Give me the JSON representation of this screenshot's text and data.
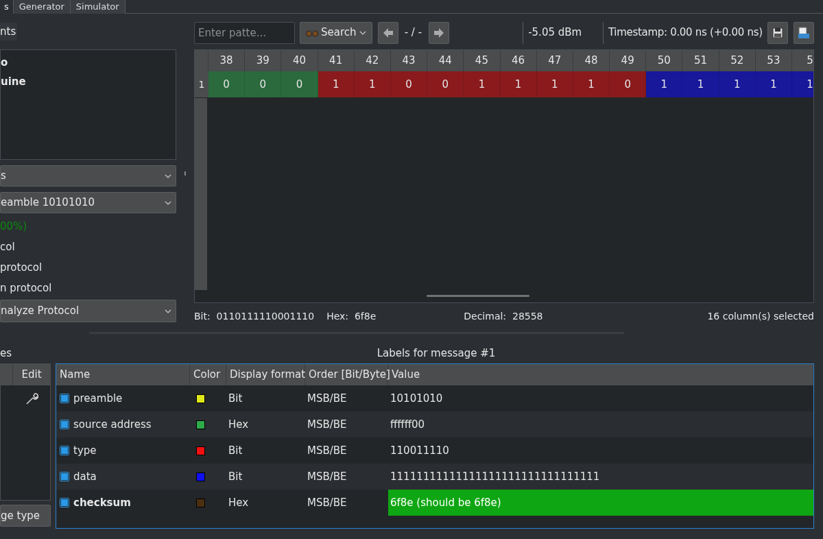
{
  "tabs": [
    {
      "label": "s",
      "selected": true
    },
    {
      "label": "Generator",
      "selected": false
    },
    {
      "label": "Simulator",
      "selected": false
    }
  ],
  "left_panel": {
    "tab": "nts",
    "list_items": [
      "o",
      "uine"
    ],
    "combo_1": "s",
    "combo_2": "eamble 10101010",
    "match_status": "00%)",
    "options": [
      "col",
      "protocol",
      "n protocol"
    ],
    "combo_3": "nalyze Protocol"
  },
  "toolbar": {
    "search_placeholder": "Enter patte...",
    "search_button": "Search",
    "position": "- / -",
    "power": "-5.05 dBm",
    "timestamp": "Timestamp: 0.00 ns (+0.00 ns)"
  },
  "grid": {
    "columns": [
      "38",
      "39",
      "40",
      "41",
      "42",
      "43",
      "44",
      "45",
      "46",
      "47",
      "48",
      "49",
      "50",
      "51",
      "52",
      "53",
      "5"
    ],
    "row_header": "1",
    "cells": [
      {
        "value": "0",
        "color": "#2a6a3c"
      },
      {
        "value": "0",
        "color": "#2a6a3c"
      },
      {
        "value": "0",
        "color": "#2a6a3c"
      },
      {
        "value": "1",
        "color": "#8a1a1c"
      },
      {
        "value": "1",
        "color": "#8a1a1c"
      },
      {
        "value": "0",
        "color": "#8a1a1c"
      },
      {
        "value": "0",
        "color": "#8a1a1c"
      },
      {
        "value": "1",
        "color": "#8a1a1c"
      },
      {
        "value": "1",
        "color": "#8a1a1c"
      },
      {
        "value": "1",
        "color": "#8a1a1c"
      },
      {
        "value": "1",
        "color": "#8a1a1c"
      },
      {
        "value": "0",
        "color": "#8a1a1c"
      },
      {
        "value": "1",
        "color": "#17189a"
      },
      {
        "value": "1",
        "color": "#17189a"
      },
      {
        "value": "1",
        "color": "#17189a"
      },
      {
        "value": "1",
        "color": "#17189a"
      },
      {
        "value": "1",
        "color": "#17189a"
      }
    ]
  },
  "status_bar": {
    "bit": "Bit:  0110111110001110",
    "hex": "Hex:  6f8e",
    "decimal": "Decimal:  28558",
    "selection": "16 column(s) selected"
  },
  "message_types": {
    "heading": "es",
    "column": "Edit",
    "button": "ge type"
  },
  "labels": {
    "title": "Labels for message #1",
    "columns": [
      "Name",
      "Color",
      "Display format",
      "Order [Bit/Byte]",
      "Value"
    ],
    "rows": [
      {
        "kind": "field",
        "checked": true,
        "name": "preamble",
        "color": "#e0e81a",
        "format": "Bit",
        "order": "MSB/BE",
        "value": "10101010"
      },
      {
        "kind": "field",
        "checked": true,
        "name": "source address",
        "color": "#2eaa4a",
        "format": "Hex",
        "order": "MSB/BE",
        "value": "ffffff00"
      },
      {
        "kind": "field",
        "checked": true,
        "name": "type",
        "color": "#f01010",
        "format": "Bit",
        "order": "MSB/BE",
        "value": "110011110"
      },
      {
        "kind": "field",
        "checked": true,
        "name": "data",
        "color": "#1010f0",
        "format": "Bit",
        "order": "MSB/BE",
        "value": "11111111111111111111111111111111"
      },
      {
        "kind": "checksum",
        "checked": true,
        "name": "checksum",
        "color": "#4a3010",
        "format": "Hex",
        "order": "MSB/BE",
        "value": "6f8e (should be 6f8e)"
      }
    ]
  }
}
